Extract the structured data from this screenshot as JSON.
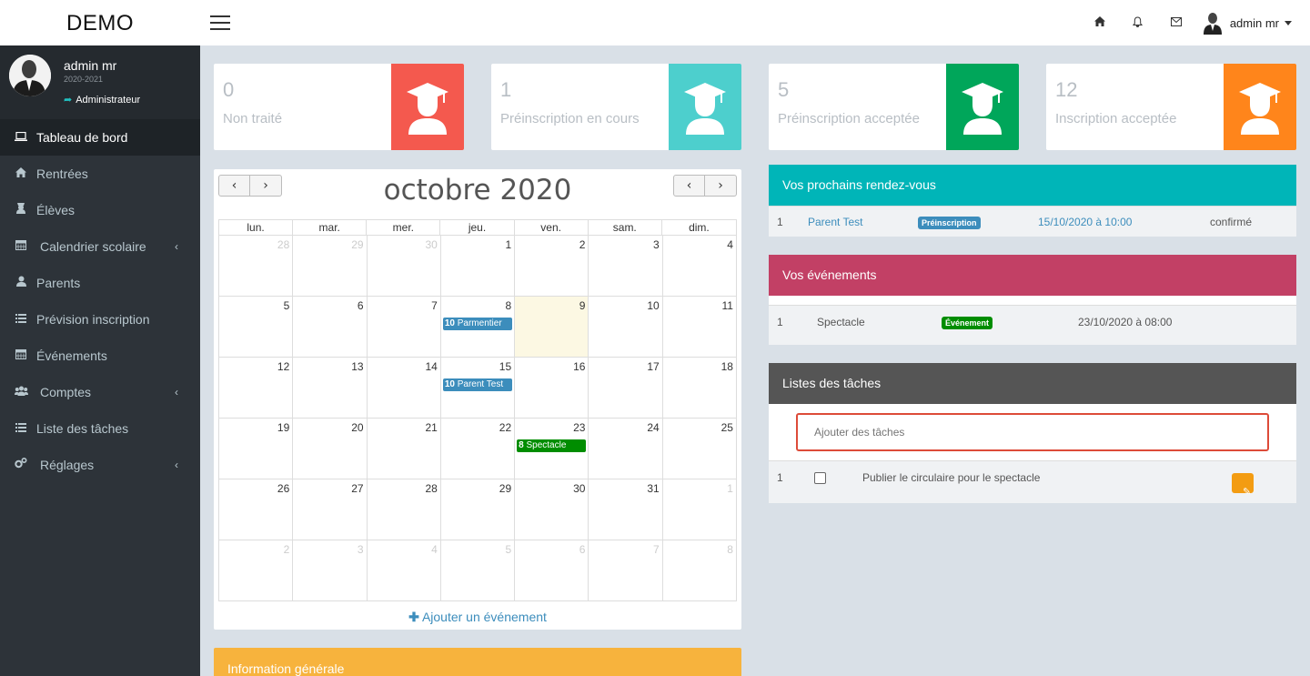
{
  "header": {
    "brand": "DEMO",
    "user_name": "admin mr",
    "icons": [
      "home-icon",
      "bell-icon",
      "envelope-icon"
    ]
  },
  "sidebar": {
    "user": {
      "name": "admin mr",
      "year": "2020-2021",
      "role": "Administrateur"
    },
    "items": [
      {
        "label": "Tableau de bord",
        "icon": "laptop-icon",
        "active": true
      },
      {
        "label": "Rentrées",
        "icon": "home-icon"
      },
      {
        "label": "Élèves",
        "icon": "student-icon"
      },
      {
        "label": "Calendrier scolaire",
        "icon": "calendar-icon",
        "has_sub": true
      },
      {
        "label": "Parents",
        "icon": "user-icon"
      },
      {
        "label": "Prévision inscription",
        "icon": "list-icon"
      },
      {
        "label": "Événements",
        "icon": "calendar-icon"
      },
      {
        "label": "Comptes",
        "icon": "users-icon",
        "has_sub": true
      },
      {
        "label": "Liste des tâches",
        "icon": "list-icon"
      },
      {
        "label": "Réglages",
        "icon": "cogs-icon",
        "has_sub": true
      }
    ]
  },
  "stats": [
    {
      "value": "0",
      "label": "Non traité",
      "color": "#f4594e"
    },
    {
      "value": "1",
      "label": "Préinscription en cours",
      "color": "#4dcfcd"
    },
    {
      "value": "5",
      "label": "Préinscription acceptée",
      "color": "#00a65a"
    },
    {
      "value": "12",
      "label": "Inscription acceptée",
      "color": "#ff851b"
    }
  ],
  "calendar": {
    "title": "octobre 2020",
    "weekdays": [
      "lun.",
      "mar.",
      "mer.",
      "jeu.",
      "ven.",
      "sam.",
      "dim."
    ],
    "weeks": [
      [
        "28",
        "29",
        "30",
        "1",
        "2",
        "3",
        "4"
      ],
      [
        "5",
        "6",
        "7",
        "8",
        "9",
        "10",
        "11"
      ],
      [
        "12",
        "13",
        "14",
        "15",
        "16",
        "17",
        "18"
      ],
      [
        "19",
        "20",
        "21",
        "22",
        "23",
        "24",
        "25"
      ],
      [
        "26",
        "27",
        "28",
        "29",
        "30",
        "31",
        "1"
      ],
      [
        "2",
        "3",
        "4",
        "5",
        "6",
        "7",
        "8"
      ]
    ],
    "events": {
      "oct8": {
        "time": "10",
        "title": "Parmentier"
      },
      "oct15": {
        "time": "10",
        "title": "Parent Test"
      },
      "oct23": {
        "time": "8",
        "title": "Spectacle"
      }
    },
    "add_event": "Ajouter un événement",
    "colors": {
      "blue_event": "#3c8dbc",
      "green_event": "#008d00",
      "today": "#fcf8e3"
    }
  },
  "info": {
    "title": "Information générale"
  },
  "appointments": {
    "title": "Vos prochains rendez-vous",
    "color": "#00b5b8",
    "rows": [
      {
        "index": "1",
        "name": "Parent Test",
        "badge": "Préinscription",
        "date": "15/10/2020 à 10:00",
        "status": "confirmé"
      }
    ]
  },
  "events_panel": {
    "title": "Vos événements",
    "color": "#c24065",
    "rows": [
      {
        "index": "1",
        "name": "Spectacle",
        "badge": "Événement",
        "date": "23/10/2020 à 08:00"
      }
    ]
  },
  "tasks": {
    "title": "Listes des tâches",
    "color": "#555555",
    "placeholder": "Ajouter des tâches",
    "rows": [
      {
        "index": "1",
        "text": "Publier le circulaire pour le spectacle"
      }
    ]
  }
}
